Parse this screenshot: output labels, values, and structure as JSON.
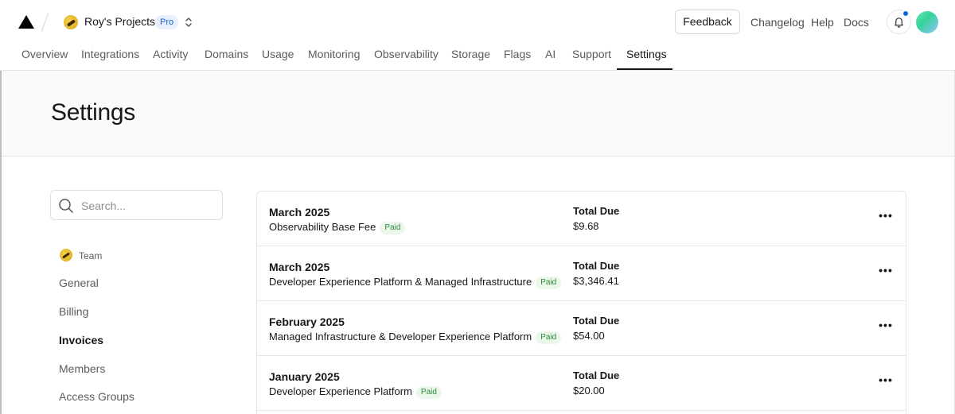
{
  "header": {
    "team_name": "Roy's Projects",
    "plan_badge": "Pro",
    "feedback_label": "Feedback",
    "links": [
      "Changelog",
      "Help",
      "Docs"
    ]
  },
  "nav": {
    "tabs": [
      "Overview",
      "Integrations",
      "Activity",
      "Domains",
      "Usage",
      "Monitoring",
      "Observability",
      "Storage",
      "Flags",
      "AI",
      "Support",
      "Settings"
    ],
    "active": "Settings"
  },
  "page": {
    "title": "Settings"
  },
  "sidebar": {
    "search_placeholder": "Search...",
    "section_label": "Team",
    "items": [
      "General",
      "Billing",
      "Invoices",
      "Members",
      "Access Groups"
    ],
    "active": "Invoices"
  },
  "invoices": {
    "total_label": "Total Due",
    "rows": [
      {
        "period": "March 2025",
        "description": "Observability Base Fee",
        "status": "Paid",
        "total": "$9.68"
      },
      {
        "period": "March 2025",
        "description": "Developer Experience Platform & Managed Infrastructure",
        "status": "Paid",
        "total": "$3,346.41"
      },
      {
        "period": "February 2025",
        "description": "Managed Infrastructure & Developer Experience Platform",
        "status": "Paid",
        "total": "$54.00"
      },
      {
        "period": "January 2025",
        "description": "Developer Experience Platform",
        "status": "Paid",
        "total": "$20.00"
      }
    ]
  },
  "colors": {
    "accent": "#171717",
    "notification_dot": "#0a66e4",
    "paid_badge_bg": "#eaf7ea",
    "paid_badge_text": "#2f8a3a",
    "pro_badge_bg": "#e8f0fe",
    "pro_badge_text": "#1f5fcf"
  }
}
